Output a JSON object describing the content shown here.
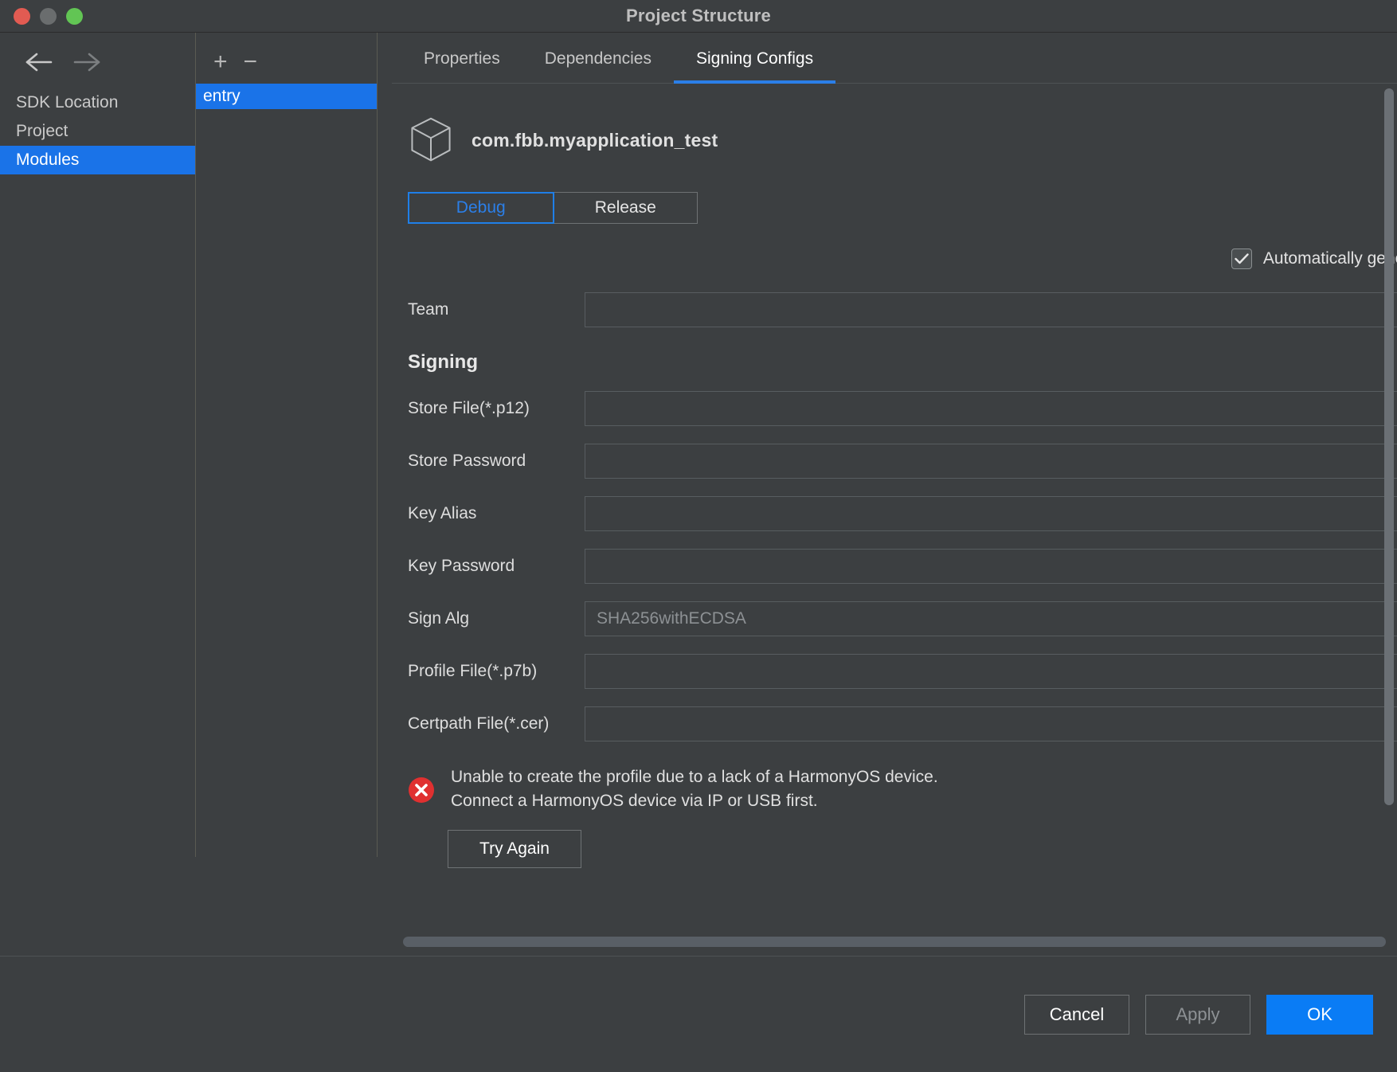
{
  "window": {
    "title": "Project Structure",
    "traffic_lights": [
      "close",
      "minimize",
      "maximize"
    ]
  },
  "nav": {
    "back_icon": "arrow-left-icon",
    "forward_icon": "arrow-right-icon",
    "items": [
      {
        "label": "SDK Location",
        "selected": false
      },
      {
        "label": "Project",
        "selected": false
      },
      {
        "label": "Modules",
        "selected": true
      }
    ]
  },
  "modules": {
    "add_label": "+",
    "remove_label": "−",
    "items": [
      {
        "label": "entry",
        "selected": true
      }
    ]
  },
  "tabs": [
    {
      "label": "Properties",
      "active": false
    },
    {
      "label": "Dependencies",
      "active": false
    },
    {
      "label": "Signing Configs",
      "active": true
    }
  ],
  "signing": {
    "app_icon": "cube-icon",
    "app_name": "com.fbb.myapplication_test",
    "build_variants": [
      {
        "label": "Debug",
        "active": true
      },
      {
        "label": "Release",
        "active": false
      }
    ],
    "auto_generate": {
      "label": "Automatically genera",
      "checked": true,
      "check_icon": "checkmark-icon"
    },
    "team": {
      "label": "Team",
      "value": "",
      "placeholder": ""
    },
    "section_title": "Signing",
    "fields": [
      {
        "label": "Store File(*.p12)",
        "value": "",
        "placeholder": ""
      },
      {
        "label": "Store Password",
        "value": "",
        "placeholder": ""
      },
      {
        "label": "Key Alias",
        "value": "",
        "placeholder": ""
      },
      {
        "label": "Key Password",
        "value": "",
        "placeholder": ""
      },
      {
        "label": "Sign Alg",
        "value": "SHA256withECDSA",
        "placeholder": "SHA256withECDSA",
        "is_placeholder": true
      },
      {
        "label": "Profile File(*.p7b)",
        "value": "",
        "placeholder": ""
      },
      {
        "label": "Certpath File(*.cer)",
        "value": "",
        "placeholder": ""
      }
    ],
    "error": {
      "icon": "error-circle-icon",
      "line1": "Unable to create the profile due to a lack of a HarmonyOS device.",
      "line2": "Connect a HarmonyOS device via IP or USB first."
    },
    "try_again_label": "Try Again"
  },
  "footer": {
    "cancel_label": "Cancel",
    "apply_label": "Apply",
    "ok_label": "OK"
  },
  "colors": {
    "accent_blue": "#0a7cf5",
    "selection_blue": "#1a73e8",
    "tab_underline": "#2b7fe8",
    "error_red": "#e03030",
    "window_bg": "#3c3f41",
    "text": "#dedede"
  }
}
